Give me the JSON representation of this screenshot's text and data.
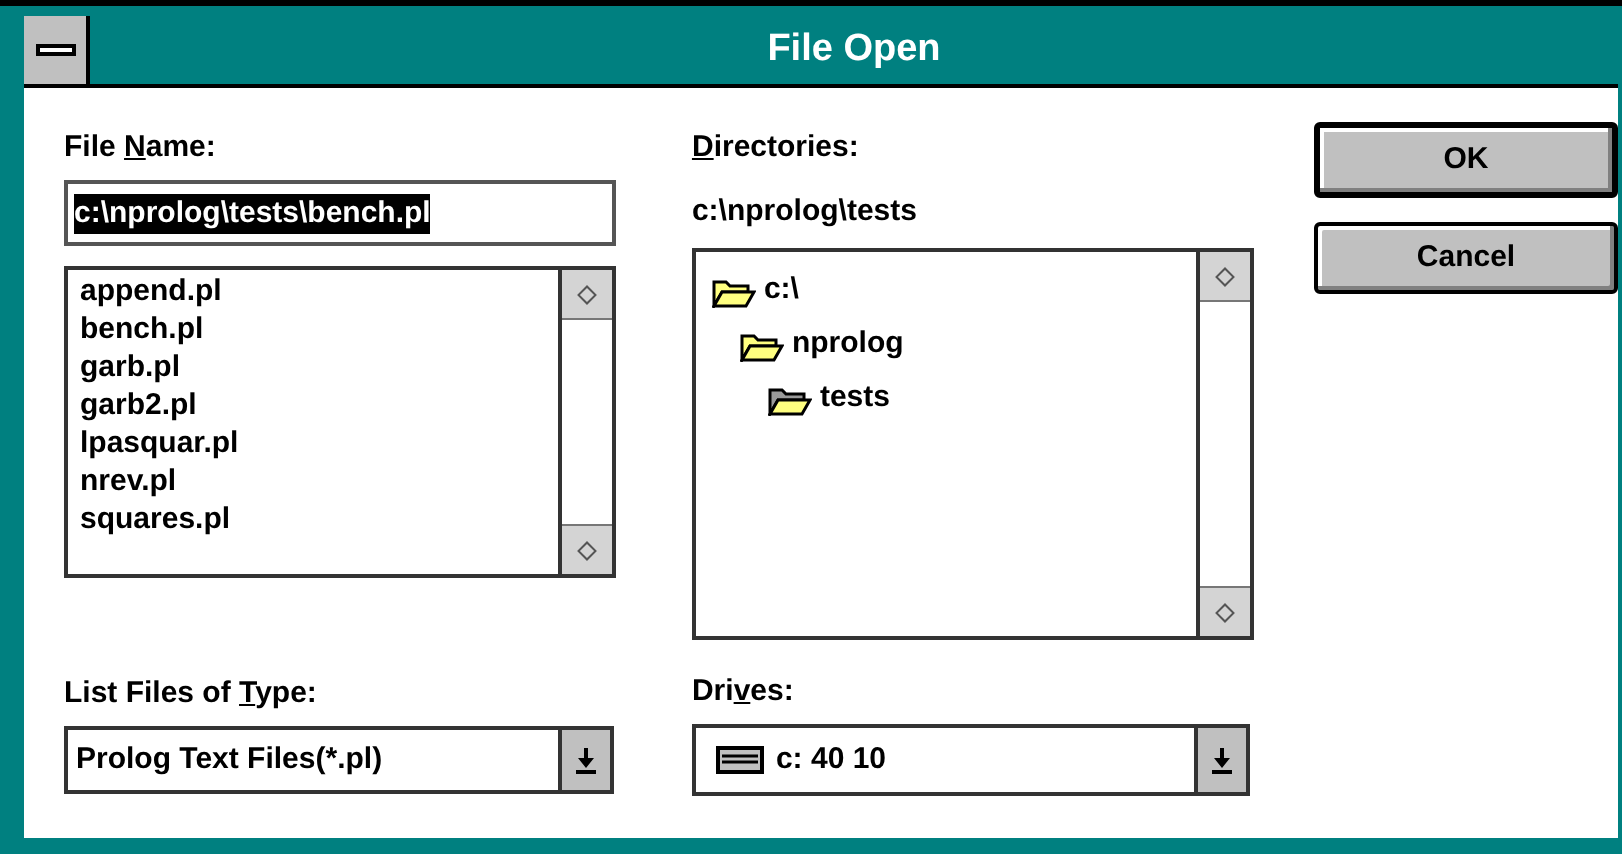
{
  "window": {
    "title": "File Open"
  },
  "file_name": {
    "label": {
      "before": "File ",
      "key": "N",
      "after": "ame:"
    },
    "value": "c:\\nprolog\\tests\\bench.pl",
    "selected": true
  },
  "files": [
    {
      "name": "append.pl"
    },
    {
      "name": "bench.pl"
    },
    {
      "name": "garb.pl"
    },
    {
      "name": "garb2.pl"
    },
    {
      "name": "lpasquar.pl"
    },
    {
      "name": "nrev.pl"
    },
    {
      "name": "squares.pl"
    }
  ],
  "directories": {
    "label": {
      "key": "D",
      "after": "irectories:"
    },
    "path": "c:\\nprolog\\tests",
    "tree": [
      {
        "name": "c:\\",
        "current": false,
        "children": [
          {
            "name": "nprolog",
            "current": false,
            "children": [
              {
                "name": "tests",
                "current": true
              }
            ]
          }
        ]
      }
    ]
  },
  "file_type": {
    "label": {
      "before": "List Files of ",
      "key": "T",
      "after": "ype:"
    },
    "value": "Prolog Text Files(*.pl)"
  },
  "drives": {
    "label": {
      "before": "Dri",
      "key": "v",
      "after": "es:"
    },
    "value": "c: 40 10"
  },
  "buttons": [
    {
      "label": "OK",
      "default": true
    },
    {
      "label": "Cancel",
      "default": false
    }
  ]
}
